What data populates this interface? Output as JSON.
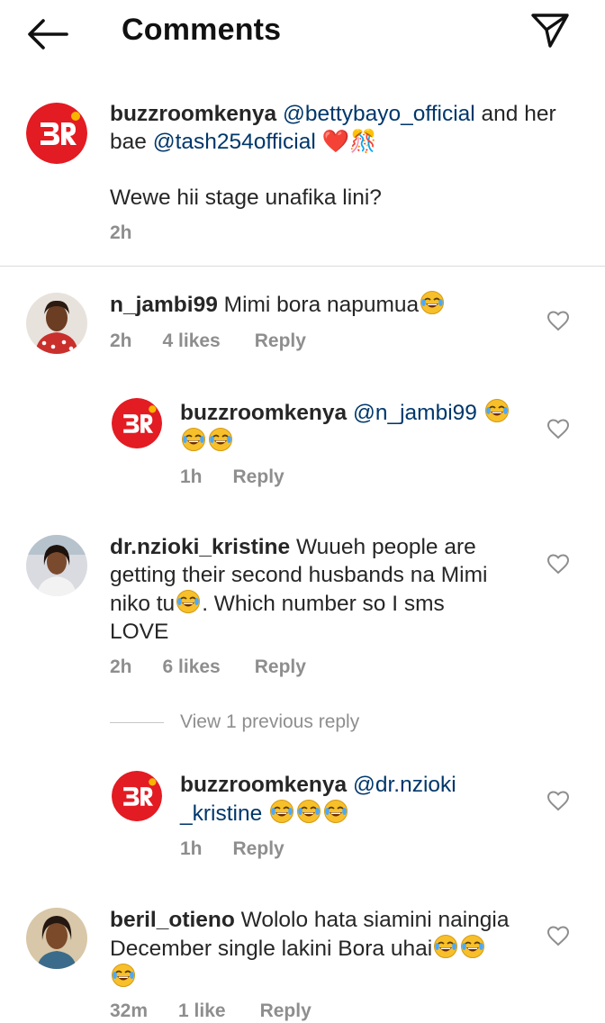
{
  "header": {
    "title": "Comments",
    "back_icon": "arrow-left-icon",
    "send_icon": "paper-plane-icon"
  },
  "caption": {
    "username": "buzzroomkenya",
    "mention1": "@bettybayo_official",
    "text1": "and her bae",
    "mention2": "@tash254official",
    "emojis": "❤️🎊",
    "body": "Wewe hii stage unafika lini?",
    "time": "2h"
  },
  "comments": [
    {
      "username": "n_jambi99",
      "text": "Mimi bora napumua",
      "time": "2h",
      "likes": "4 likes",
      "reply": "Reply"
    },
    {
      "username": "buzzroomkenya",
      "mention": "@n_jambi99",
      "time": "1h",
      "reply": "Reply"
    },
    {
      "username": "dr.nzioki_kristine",
      "text_line1": "Wuueh people are",
      "text_line2": "getting their second husbands na Mimi",
      "text_line3a": "niko tu",
      "text_line3b": ". Which number so I sms",
      "text_line4": "LOVE",
      "time": "2h",
      "likes": "6 likes",
      "reply": "Reply"
    },
    {
      "view_replies": "View 1 previous reply"
    },
    {
      "username": "buzzroomkenya",
      "mention_line1": "@dr.nzioki",
      "mention_line2": "_kristine",
      "time": "1h",
      "reply": "Reply"
    },
    {
      "username": "beril_otieno",
      "text_line1": "Wololo hata siamini naingia",
      "text_line2": "December single lakini Bora uhai",
      "time": "32m",
      "likes": "1 like",
      "reply": "Reply"
    }
  ],
  "logo_text": "BR",
  "colors": {
    "brand_red": "#e31b23",
    "mention_blue": "#00376b",
    "meta_gray": "#8e8e8e"
  }
}
